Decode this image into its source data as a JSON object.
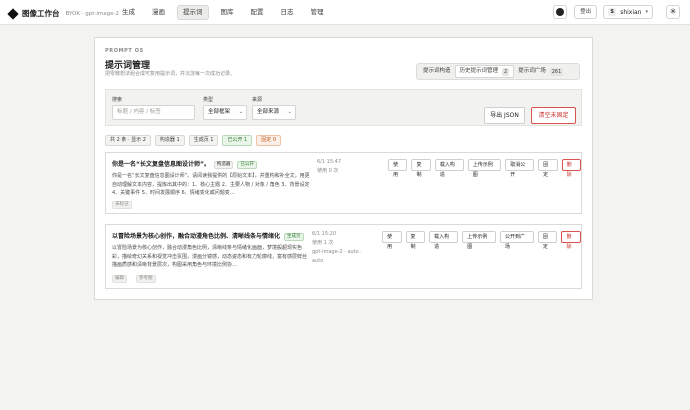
{
  "app": {
    "name": "图像工作台",
    "mode": "BYOK",
    "model": "gpt-image-2"
  },
  "nav": [
    {
      "label": "生成",
      "active": false
    },
    {
      "label": "漫画",
      "active": false
    },
    {
      "label": "提示词",
      "active": true
    },
    {
      "label": "图库",
      "active": false
    },
    {
      "label": "配置",
      "active": false
    },
    {
      "label": "日志",
      "active": false
    },
    {
      "label": "管理",
      "active": false
    }
  ],
  "topbar": {
    "logout_label": "登出",
    "user_initial": "S",
    "username": "shixian",
    "github_icon": "github-icon",
    "theme_icon": "sun-icon"
  },
  "page": {
    "kicker": "PROMPT OS",
    "title": "提示词管理",
    "desc": "把零散想法组合成可复用提示词，并沉淀每一次成功记录。"
  },
  "tabs": [
    {
      "label": "提示词构造",
      "active": false,
      "count": ""
    },
    {
      "label": "历史提示词管理",
      "active": true,
      "count": "2"
    },
    {
      "label": "提示词广场",
      "active": false,
      "count": "261"
    }
  ],
  "filters": {
    "search_label": "搜索",
    "search_placeholder": "标题 / 内容 / 标签",
    "type_label": "类型",
    "type_value": "全部框架",
    "source_label": "来源",
    "source_value": "全部来源",
    "export_label": "导出 JSON",
    "clear_label": "清空未固定"
  },
  "stats": [
    {
      "label": "共 2 条 · 显示 2",
      "kind": "plain"
    },
    {
      "label": "构造器 1",
      "kind": "plain"
    },
    {
      "label": "生成页 1",
      "kind": "plain"
    },
    {
      "label": "已公开 1",
      "kind": "green"
    },
    {
      "label": "固定 0",
      "kind": "orange"
    }
  ],
  "prompts": [
    {
      "title": "你是一名“长文复盘信息图设计师”。",
      "tags": [
        {
          "label": "构造器",
          "kind": "plain"
        },
        {
          "label": "已公开",
          "kind": "green"
        }
      ],
      "body": "你是一名“长文复盘信息图设计师”。请阅读我提供的【原始文本】，并重构和补全文，用更自动理解文本内容，提炼出其中的：1、核心主题 2、主要人物 / 对象 / 角色 3、背景设定 4、关键事件 5、时间发展顺序 6、情绪变化或问题变...",
      "labels": [
        "未标记"
      ],
      "meta": [
        "6/1 15:47",
        "使用 0 次"
      ],
      "actions": [
        "使用",
        "复制",
        "载入构造",
        "上传示例图",
        "取消公开",
        "固定",
        "删除"
      ]
    },
    {
      "title": "以冒险场景为核心创作，融合动漫角色比例、清晰线条与情绪化",
      "tags": [
        {
          "label": "生成页",
          "kind": "green"
        }
      ],
      "body": "以冒险场景为核心创作，融合动漫角色比例，清晰线条与情绪化画面，梦境般超现实色彩，描绘奇幻关系和视觉冲击氛围，漫画分镜感，动态姿态和有力轮廓线，富有感层鲜丝描画质感和清晰背景层次，构图采用角色与环境比例协...",
      "labels": [
        "编辑",
        "参考图"
      ],
      "meta": [
        "6/1 15:20",
        "使用 1 次",
        "gpt-image-2 · auto · auto"
      ],
      "actions": [
        "使用",
        "复制",
        "载入构造",
        "上传示例图",
        "公开到广场",
        "固定",
        "删除"
      ]
    }
  ]
}
